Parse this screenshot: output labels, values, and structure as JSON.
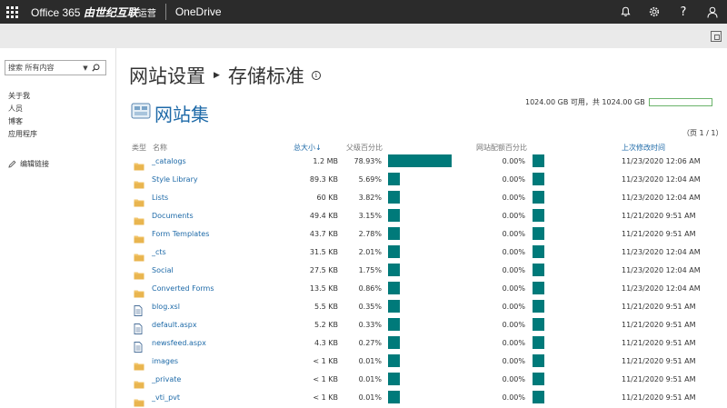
{
  "suite": {
    "brand_main": "Office 365 ",
    "brand_cn": "由世纪互联",
    "brand_small": "运营",
    "app_name": "OneDrive"
  },
  "search": {
    "placeholder": "搜索 所有内容"
  },
  "nav": {
    "links": [
      "关于我",
      "人员",
      "博客",
      "应用程序"
    ],
    "edit_links": "编辑链接"
  },
  "breadcrumb": {
    "parent": "网站设置",
    "current": "存储标准"
  },
  "site_collection": "网站集",
  "storage": {
    "text": "1024.00 GB 可用，共 1024.00 GB",
    "used_fraction": 0.0
  },
  "page_info": "（页 1 / 1）",
  "columns": {
    "type": "类型",
    "name": "名称",
    "total_size": "总大小↓",
    "parent_pct": "父级百分比",
    "quota_pct": "网站配额百分比",
    "modified": "上次修改时间"
  },
  "rows": [
    {
      "icon": "folder-icon",
      "name": "_catalogs",
      "size": "1.2 MB",
      "parent_pct": "78.93%",
      "quota_pct": "0.00%",
      "modified": "11/23/2020 12:06 AM",
      "parent_val": 78.93
    },
    {
      "icon": "folder-icon",
      "name": "Style Library",
      "size": "89.3 KB",
      "parent_pct": "5.69%",
      "quota_pct": "0.00%",
      "modified": "11/23/2020 12:04 AM",
      "parent_val": 5.69
    },
    {
      "icon": "folder-icon",
      "name": "Lists",
      "size": "60 KB",
      "parent_pct": "3.82%",
      "quota_pct": "0.00%",
      "modified": "11/23/2020 12:04 AM",
      "parent_val": 3.82
    },
    {
      "icon": "folder-icon",
      "name": "Documents",
      "size": "49.4 KB",
      "parent_pct": "3.15%",
      "quota_pct": "0.00%",
      "modified": "11/21/2020 9:51 AM",
      "parent_val": 3.15
    },
    {
      "icon": "folder-icon",
      "name": "Form Templates",
      "size": "43.7 KB",
      "parent_pct": "2.78%",
      "quota_pct": "0.00%",
      "modified": "11/21/2020 9:51 AM",
      "parent_val": 2.78
    },
    {
      "icon": "folder-icon",
      "name": "_cts",
      "size": "31.5 KB",
      "parent_pct": "2.01%",
      "quota_pct": "0.00%",
      "modified": "11/23/2020 12:04 AM",
      "parent_val": 2.01
    },
    {
      "icon": "folder-icon",
      "name": "Social",
      "size": "27.5 KB",
      "parent_pct": "1.75%",
      "quota_pct": "0.00%",
      "modified": "11/23/2020 12:04 AM",
      "parent_val": 1.75
    },
    {
      "icon": "folder-icon",
      "name": "Converted Forms",
      "size": "13.5 KB",
      "parent_pct": "0.86%",
      "quota_pct": "0.00%",
      "modified": "11/23/2020 12:04 AM",
      "parent_val": 0.86
    },
    {
      "icon": "file-icon",
      "name": "blog.xsl",
      "size": "5.5 KB",
      "parent_pct": "0.35%",
      "quota_pct": "0.00%",
      "modified": "11/21/2020 9:51 AM",
      "parent_val": 0.35
    },
    {
      "icon": "file-icon",
      "name": "default.aspx",
      "size": "5.2 KB",
      "parent_pct": "0.33%",
      "quota_pct": "0.00%",
      "modified": "11/21/2020 9:51 AM",
      "parent_val": 0.33
    },
    {
      "icon": "file-icon",
      "name": "newsfeed.aspx",
      "size": "4.3 KB",
      "parent_pct": "0.27%",
      "quota_pct": "0.00%",
      "modified": "11/21/2020 9:51 AM",
      "parent_val": 0.27
    },
    {
      "icon": "folder-icon",
      "name": "images",
      "size": "< 1 KB",
      "parent_pct": "0.01%",
      "quota_pct": "0.00%",
      "modified": "11/21/2020 9:51 AM",
      "parent_val": 0.01
    },
    {
      "icon": "folder-icon",
      "name": "_private",
      "size": "< 1 KB",
      "parent_pct": "0.01%",
      "quota_pct": "0.00%",
      "modified": "11/21/2020 9:51 AM",
      "parent_val": 0.01
    },
    {
      "icon": "folder-icon",
      "name": "_vti_pvt",
      "size": "< 1 KB",
      "parent_pct": "0.01%",
      "quota_pct": "0.00%",
      "modified": "11/21/2020 9:51 AM",
      "parent_val": 0.01
    }
  ],
  "colors": {
    "accent": "#1e6aa8",
    "bar": "#007a7a",
    "folder": "#f2c66d"
  }
}
